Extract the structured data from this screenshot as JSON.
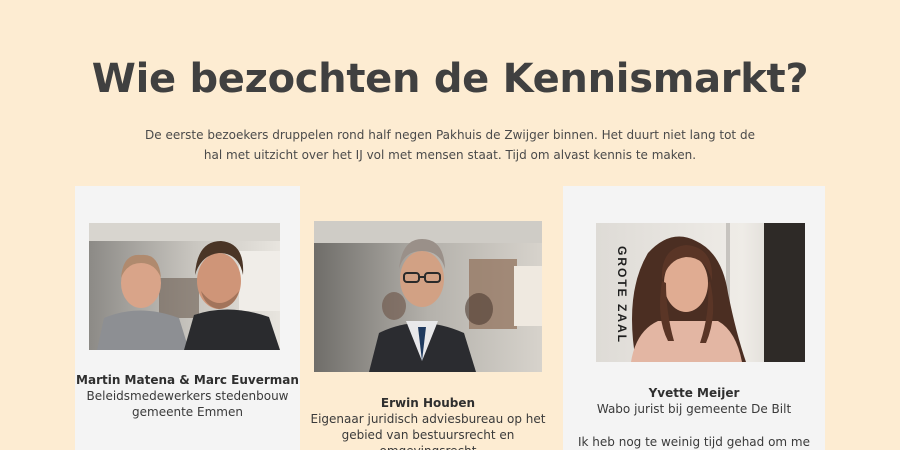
{
  "page": {
    "title": "Wie bezochten de Kennismarkt?",
    "intro": "De eerste bezoekers druppelen rond half negen Pakhuis de Zwijger binnen. Het duurt niet lang tot de hal met uitzicht over het IJ vol met mensen staat. Tijd om alvast kennis te maken."
  },
  "colors": {
    "background": "#fdecd2",
    "card": "#f4f4f4",
    "heading": "#404040"
  },
  "cards": [
    {
      "name": "Martin Matena & Marc Euverman",
      "role": "Beleidsmedewerkers stedenbouw gemeente Emmen",
      "photo": "portrait-two-men"
    },
    {
      "name": "Erwin Houben",
      "role": "Eigenaar juridisch adviesbureau op het gebied van bestuursrecht en omgevingsrecht",
      "photo": "portrait-man-glasses"
    },
    {
      "name": "Yvette Meijer",
      "role": "Wabo jurist bij gemeente De Bilt",
      "quote": "Ik heb nog te weinig tijd gehad om me",
      "photo_sign_text": "GROTE ZAAL",
      "photo": "portrait-woman"
    }
  ]
}
